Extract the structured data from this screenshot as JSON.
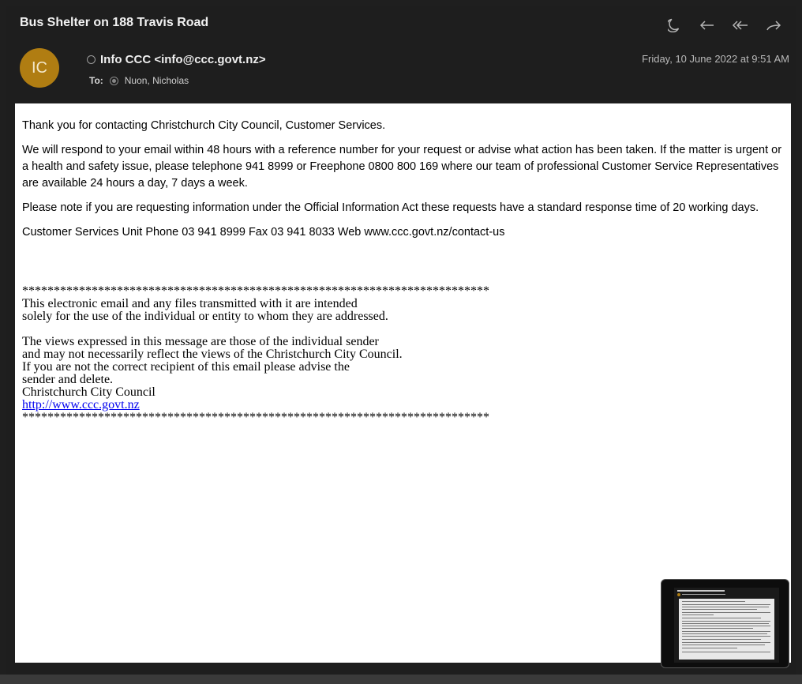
{
  "email": {
    "subject": "Bus Shelter on 188 Travis Road",
    "avatar_initials": "IC",
    "from": "Info CCC <info@ccc.govt.nz>",
    "to_label": "To:",
    "to": "Nuon, Nicholas",
    "date": "Friday, 10 June 2022 at 9:51 AM"
  },
  "toolbar": {
    "icons": [
      "moon-icon",
      "reply-icon",
      "reply-all-icon",
      "forward-icon"
    ]
  },
  "body": {
    "paragraphs": [
      "Thank you for contacting Christchurch City Council, Customer Services.",
      "We will respond to your email within 48 hours with a reference number for your request or advise what action has been taken. If the matter is urgent or a health and safety issue, please telephone 941 8999 or Freephone 0800 800 169 where our team of professional Customer Service Representatives are available 24 hours a day, 7 days a week.",
      "Please note if you are requesting information under the Official Information Act these requests have a standard response time of 20 working days.",
      "Customer Services Unit Phone 03 941 8999 Fax 03 941 8033 Web www.ccc.govt.nz/contact-us"
    ],
    "stars": "**************************************************************************",
    "disclaimer_1": "This electronic email and any files transmitted with it are intended",
    "disclaimer_2": "solely for the use of the individual or entity to whom they are addressed.",
    "disclaimer_3": "The views expressed in this message are those of the individual sender",
    "disclaimer_4": "and may not necessarily reflect the views of the Christchurch City Council.",
    "disclaimer_5": "If you are not the correct recipient of this email please advise the",
    "disclaimer_6": "sender and delete.",
    "signature": "Christchurch City Council",
    "link": "http://www.ccc.govt.nz"
  },
  "colors": {
    "avatar": "#b07d12",
    "link": "#0000ee"
  }
}
